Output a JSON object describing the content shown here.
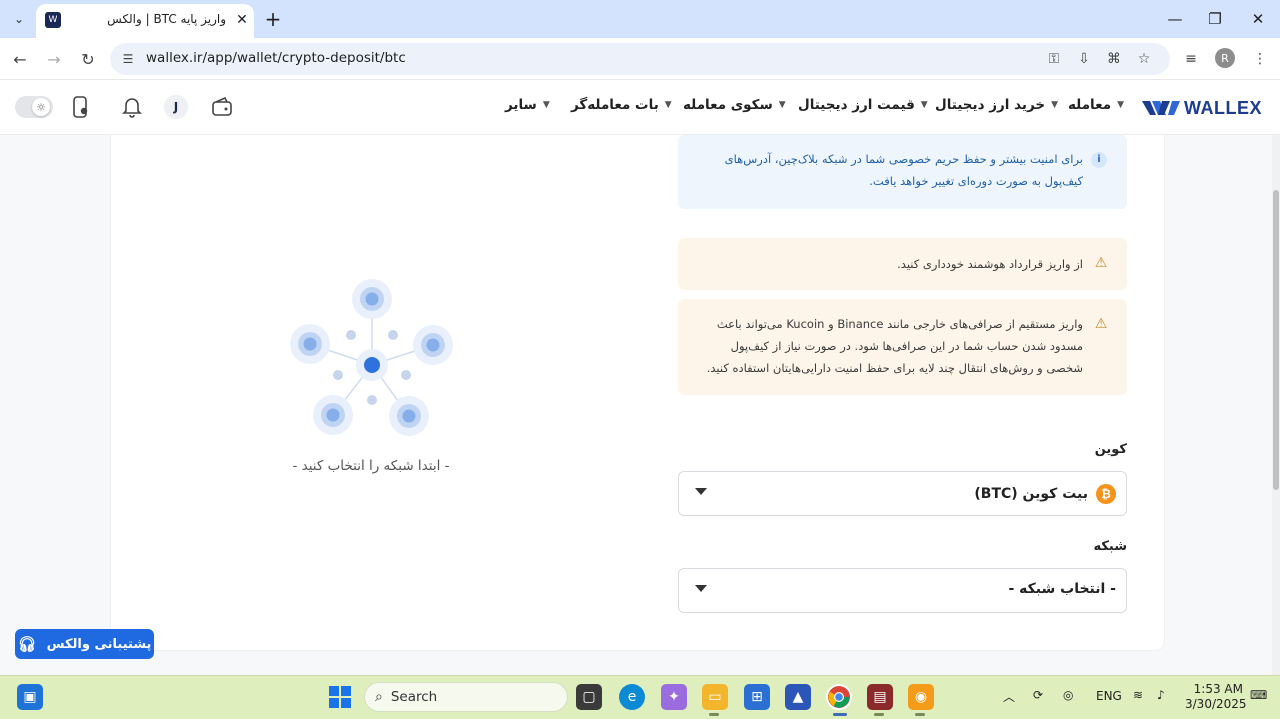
{
  "browser": {
    "tab_title": "واریز پایه BTC | والکس",
    "url": "wallex.ir/app/wallet/crypto-deposit/btc",
    "profile_initial": "R"
  },
  "header": {
    "logo_text": "WALLEX",
    "menu": [
      "معامله",
      "خرید ارز دیجیتال",
      "قیمت ارز دیجیتال",
      "سکوی معامله",
      "بات معامله‌گر",
      "سایر"
    ],
    "avatar_initial": "J"
  },
  "alerts": {
    "info": "برای امنیت بیشتر و حفظ حریم خصوصی شما در شبکه بلاک‌چین، آدرس‌های کیف‌پول به صورت دوره‌ای تغییر خواهد یافت.",
    "warn_contract": "از واریز قرارداد هوشمند خودداری کنید.",
    "warn_exchanges": "واریز مستقیم از صرافی‌های خارجی مانند Binance و Kucoin می‌تواند باعث مسدود شدن حساب شما در این صرافی‌ها شود. در صورت نیاز از کیف‌پول شخصی و روش‌های انتقال چند لایه برای حفظ امنیت دارایی‌هایتان استفاده کنید."
  },
  "form": {
    "coin_label": "کوین",
    "coin_value": "بیت کوین (BTC)",
    "network_label": "شبکه",
    "network_value": "- انتخاب شبکه -"
  },
  "empty_state": {
    "text": "- ابتدا شبکه را انتخاب کنید -"
  },
  "support_button": "پشتیبانی والکس",
  "taskbar": {
    "search_placeholder": "Search",
    "language": "ENG",
    "time": "1:53 AM",
    "date": "3/30/2025"
  },
  "colors": {
    "brand": "#1c3d8f",
    "primary": "#1f6ae0",
    "info_bg": "#eef5fd",
    "warn_bg": "#fdf5ea",
    "bitcoin": "#f7931a"
  }
}
